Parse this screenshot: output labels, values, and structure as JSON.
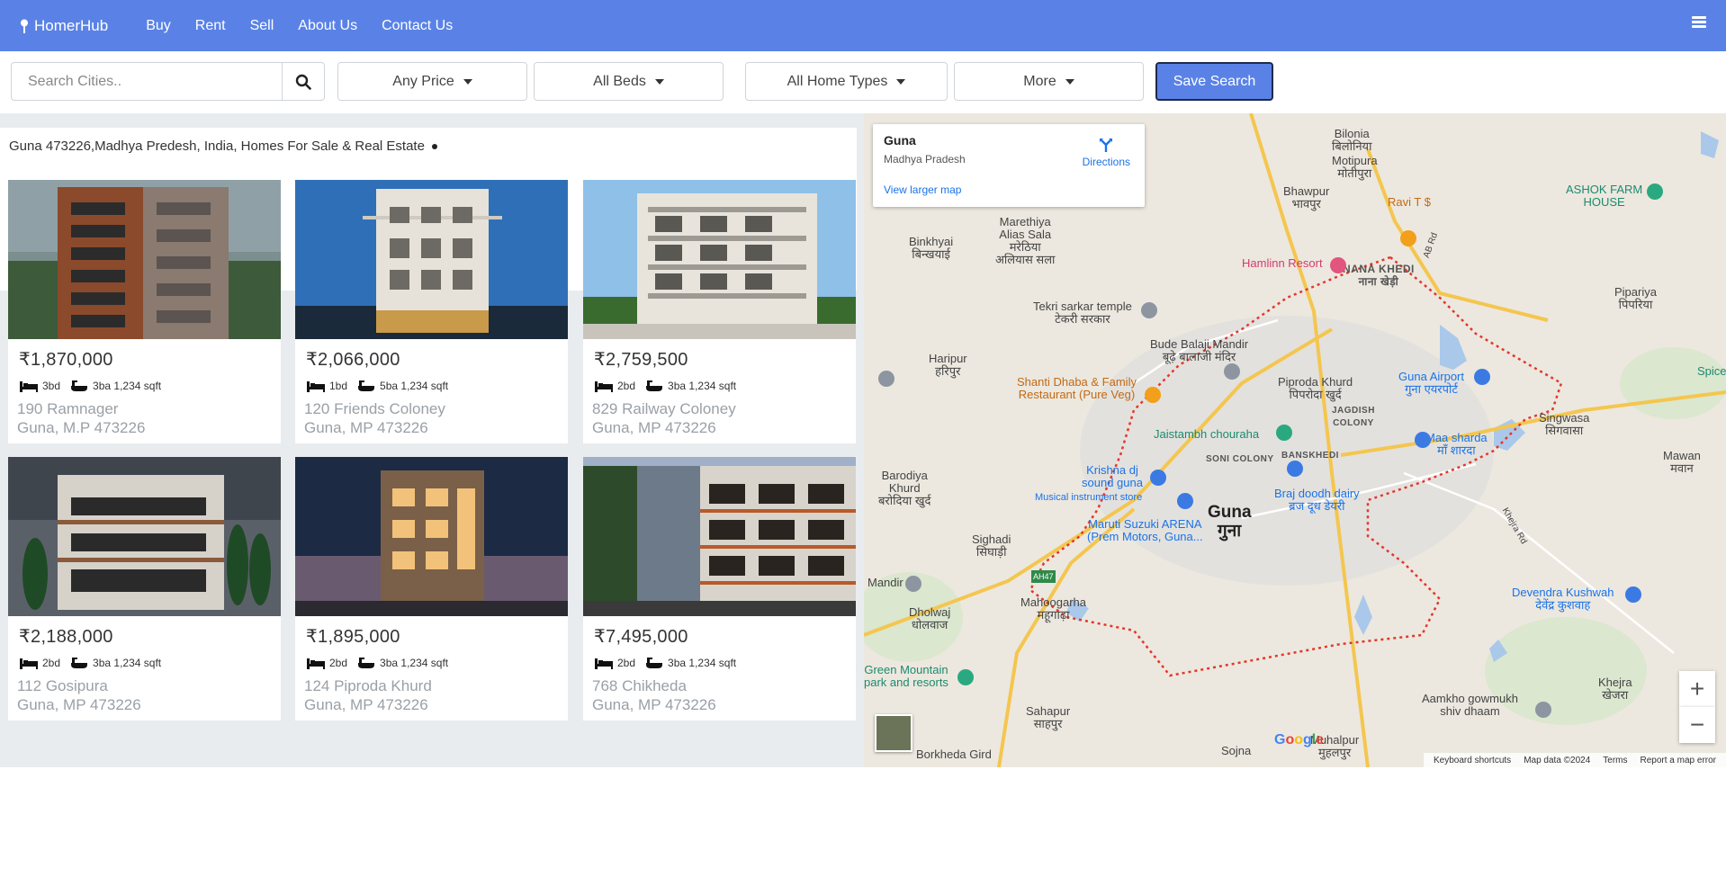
{
  "nav": {
    "brand": "HomerHub",
    "links": [
      "Buy",
      "Rent",
      "Sell",
      "About Us",
      "Contact Us"
    ]
  },
  "search": {
    "placeholder": "Search Cities..",
    "filters": [
      "Any Price",
      "All Beds",
      "All Home Types",
      "More"
    ],
    "save_label": "Save Search"
  },
  "results_title": "Guna 473226,Madhya Predesh, India, Homes For Sale & Real Estate",
  "listings": [
    {
      "price": "₹1,870,000",
      "beds": "3bd",
      "baths": "3ba",
      "sqft": "1,234 sqft",
      "street": "190 Ramnager",
      "city": "Guna, M.P 473226"
    },
    {
      "price": "₹2,066,000",
      "beds": "1bd",
      "baths": "5ba",
      "sqft": "1,234 sqft",
      "street": "120 Friends Coloney",
      "city": "Guna, MP 473226"
    },
    {
      "price": "₹2,759,500",
      "beds": "2bd",
      "baths": "3ba",
      "sqft": "1,234 sqft",
      "street": "829 Railway Coloney",
      "city": "Guna, MP 473226"
    },
    {
      "price": "₹2,188,000",
      "beds": "2bd",
      "baths": "3ba",
      "sqft": "1,234 sqft",
      "street": "112 Gosipura",
      "city": "Guna, MP 473226"
    },
    {
      "price": "₹1,895,000",
      "beds": "2bd",
      "baths": "3ba",
      "sqft": "1,234 sqft",
      "street": "124 Piproda Khurd",
      "city": "Guna, MP 473226"
    },
    {
      "price": "₹7,495,000",
      "beds": "2bd",
      "baths": "3ba",
      "sqft": "1,234 sqft",
      "street": "768 Chikheda",
      "city": "Guna, MP 473226"
    }
  ],
  "map": {
    "place": "Guna",
    "region": "Madhya Pradesh",
    "directions": "Directions",
    "larger_map": "View larger map",
    "city_label": "Guna",
    "city_label_hi": "गुना",
    "labels": {
      "bilonia": "Bilonia\nबिलोनिया",
      "motipura": "Motipura\nमोतीपुरा",
      "bhawpur": "Bhawpur\nभावपुर",
      "ashok": "ASHOK FARM\nHOUSE",
      "ravi": "Ravi T $",
      "marethiya": "Marethiya\nAlias Sala\nमरेठिया\nअलियास सला",
      "binkhyai": "Binkhyai\nबिन्खयाई",
      "hamlinn": "Hamlinn Resort",
      "nana_khedi": "NANA KHEDI\nनाना खेड़ी",
      "pipariya": "Pipariya\nपिपरिया",
      "tekri": "Tekri sarkar temple\nटेकरी सरकार",
      "bude_balaji": "Bude Balaji Mandir\nबूढ़े बालाजी मंदिर",
      "haripur": "Haripur\nहरिपुर",
      "shanti": "Shanti Dhaba & Family\nRestaurant (Pure Veg)",
      "piproda": "Piproda Khurd\nपिपरोदा खुर्द",
      "jagdish": "JAGDISH\nCOLONY",
      "guna_airport": "Guna Airport\nगुना एयरपोर्ट",
      "singwasa": "Singwasa\nसिगवासा",
      "jaistambh": "Jaistambh chouraha",
      "soni": "SONI COLONY",
      "banskhedi": "BANSKHEDI",
      "maa_sharda": "Maa sharda\nमाँ शारदा",
      "mawan": "Mawan\nमवान",
      "barodiya": "Barodiya\nKhurd\nबरोदिया खुर्द",
      "krishna": "Krishna dj\nsound guna",
      "musical": "Musical instrument store",
      "braj": "Braj doodh dairy\nब्रज दूध डेयरी",
      "maruti": "Maruti Suzuki ARENA\n(Prem Motors, Guna...",
      "sighadi": "Sighadi\nसिघाड़ी",
      "mandir": "Mandir",
      "dholwaj": "Dholwaj\nधोलवाज",
      "mahoogarha": "Mahoogarha\nमहूगाढ़ा",
      "devendra": "Devendra Kushwah\nदेवेंद्र कुशवाह",
      "green_mountain": "Green Mountain\npark and resorts",
      "khejra": "Khejra\nखेजरा",
      "aamkho": "Aamkho gowmukh\nshiv dhaam",
      "sahapur": "Sahapur\nसाहपुर",
      "sojna": "Sojna",
      "muhalpur": "Muhalpur\nमुहलपुर",
      "borkheda": "Borkheda Gird",
      "spice": "Spice",
      "khejra_rd": "Khejra Rd",
      "ab_rd": "AB Rd",
      "ah47": "AH47"
    },
    "footer": [
      "Keyboard shortcuts",
      "Map data ©2024",
      "Terms",
      "Report a map error"
    ],
    "google": "Google"
  }
}
